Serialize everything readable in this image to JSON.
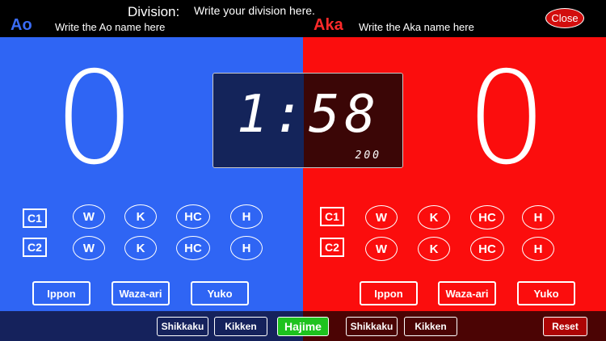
{
  "header": {
    "division_label": "Division:",
    "division_value": "Write your division here.",
    "ao_label": "Ao",
    "ao_name": "Write the Ao name here",
    "aka_label": "Aka",
    "aka_name": "Write the Aka name here",
    "close_label": "Close"
  },
  "ao": {
    "score": "0",
    "c1": "C1",
    "c2": "C2",
    "penalties": [
      "W",
      "K",
      "HC",
      "H"
    ],
    "buttons": {
      "ippon": "Ippon",
      "wazaari": "Waza-ari",
      "yuko": "Yuko"
    }
  },
  "aka": {
    "score": "0",
    "c1": "C1",
    "c2": "C2",
    "penalties": [
      "W",
      "K",
      "HC",
      "H"
    ],
    "buttons": {
      "ippon": "Ippon",
      "wazaari": "Waza-ari",
      "yuko": "Yuko"
    }
  },
  "timer": {
    "display": "1:58",
    "sub": "200"
  },
  "bottom": {
    "ao_shikkaku": "Shikkaku",
    "ao_kikken": "Kikken",
    "hajime": "Hajime",
    "aka_shikkaku": "Shikkaku",
    "aka_kikken": "Kikken",
    "reset": "Reset"
  },
  "colors": {
    "ao": "#2f65f4",
    "aka": "#fb0d0d",
    "hajime": "#1ec21e"
  }
}
